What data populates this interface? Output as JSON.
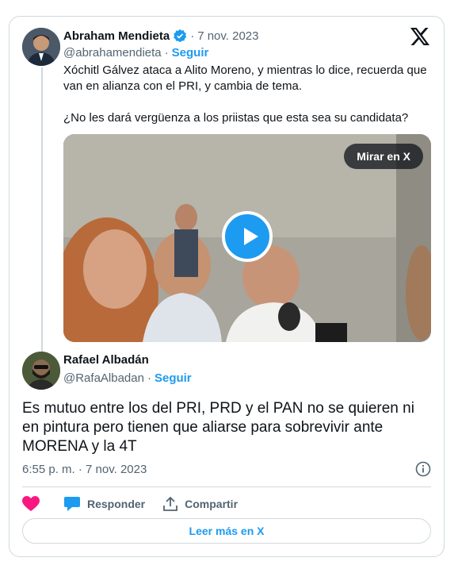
{
  "quoted_tweet": {
    "author_name": "Abraham Mendieta",
    "separator": "·",
    "date": "7 nov. 2023",
    "handle": "@abrahamendieta",
    "follow_label": "Seguir",
    "text_p1": "Xóchitl Gálvez ataca a Alito Moreno, y mientras lo dice, recuerda que van en alianza con el PRI, y cambia de tema.",
    "text_p2": "¿No les dará vergüenza a los priistas que esta sea su candidata?",
    "video_button": "Mirar en X"
  },
  "tweet": {
    "author_name": "Rafael Albadán",
    "handle": "@RafaAlbadan",
    "separator": "·",
    "follow_label": "Seguir",
    "text": "Es mutuo entre los del PRI, PRD y el PAN no se quieren ni en pintura pero tienen que aliarse para sobrevivir ante MORENA y la 4T",
    "timestamp": "6:55 p. m. · 7 nov. 2023"
  },
  "actions": {
    "reply_label": "Responder",
    "share_label": "Compartir"
  },
  "read_more_label": "Leer más en X",
  "colors": {
    "accent": "#1d9bf0",
    "like": "#f91880",
    "muted": "#536471",
    "border": "#cfd9de"
  },
  "icons": [
    "x-logo-icon",
    "verified-badge-icon",
    "play-icon",
    "info-icon",
    "heart-icon",
    "reply-bubble-icon",
    "share-upload-icon"
  ]
}
